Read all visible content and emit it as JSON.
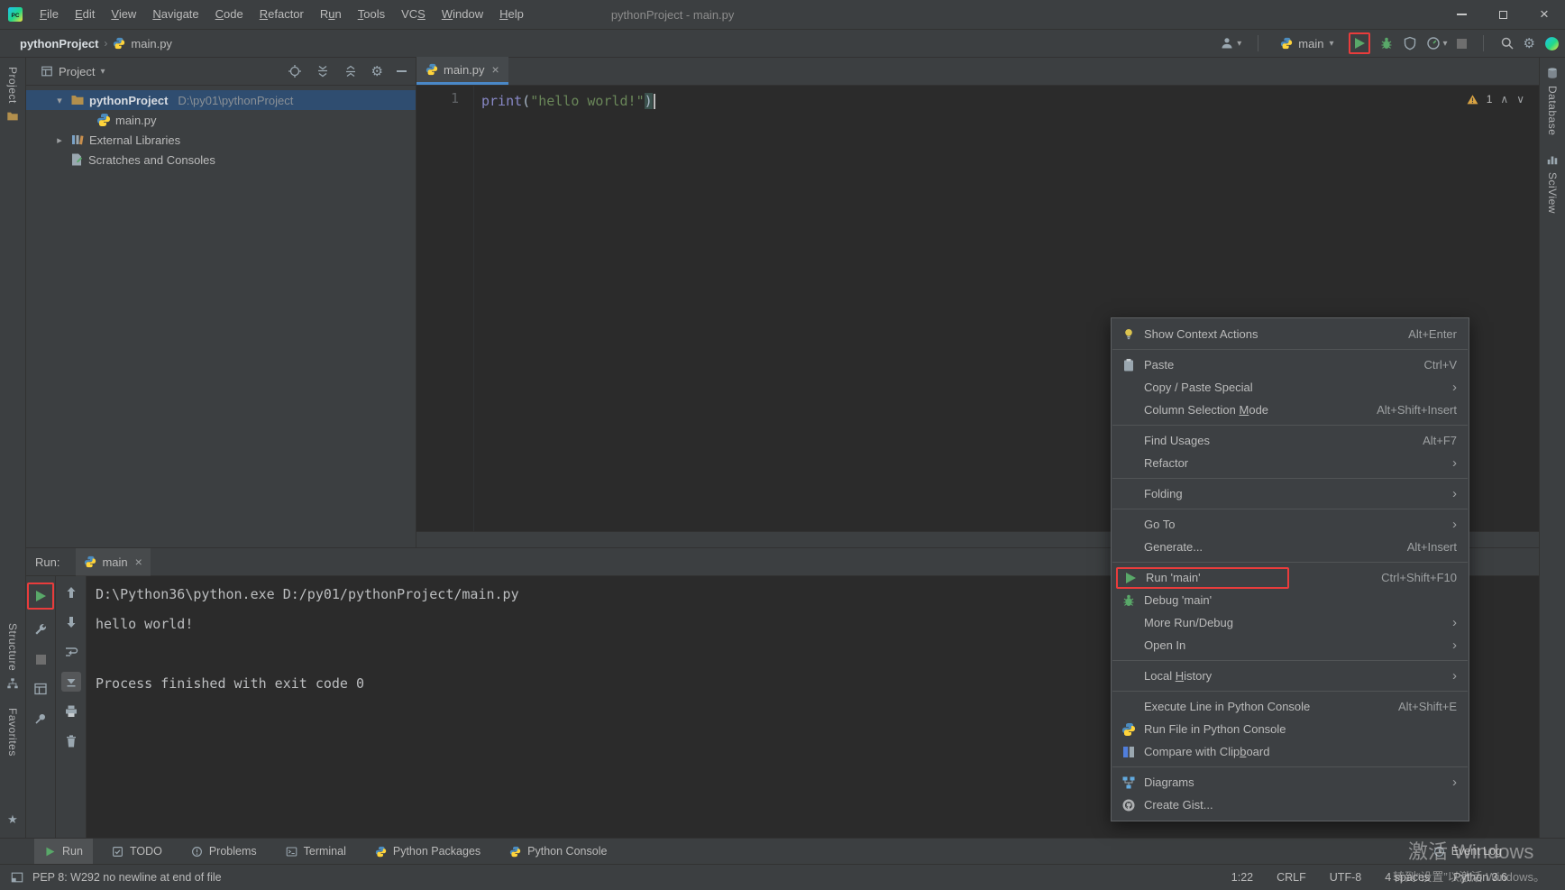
{
  "colors": {
    "annotation_red": "#e93c3c",
    "run_green": "#59a869",
    "selection_blue": "#2f4d70",
    "string_green": "#6a8759",
    "builtin_violet": "#8888c6",
    "panel_gray": "#3c3f41",
    "editor_dark": "#2b2b2b"
  },
  "titlebar": {
    "title": "pythonProject - main.py",
    "menus": [
      {
        "label": "File",
        "mnemonic": "F"
      },
      {
        "label": "Edit",
        "mnemonic": "E"
      },
      {
        "label": "View",
        "mnemonic": "V"
      },
      {
        "label": "Navigate",
        "mnemonic": "N"
      },
      {
        "label": "Code",
        "mnemonic": "C"
      },
      {
        "label": "Refactor",
        "mnemonic": "R"
      },
      {
        "label": "Run",
        "mnemonic": "u"
      },
      {
        "label": "Tools",
        "mnemonic": "T"
      },
      {
        "label": "VCS",
        "mnemonic": "S"
      },
      {
        "label": "Window",
        "mnemonic": "W"
      },
      {
        "label": "Help",
        "mnemonic": "H"
      }
    ]
  },
  "navbar": {
    "project_crumb": "pythonProject",
    "file_crumb": "main.py",
    "run_config": "main"
  },
  "left_stripe": {
    "project": "Project",
    "structure": "Structure",
    "favorites": "Favorites"
  },
  "right_stripe": {
    "database": "Database",
    "sciview": "SciView"
  },
  "project_panel": {
    "title": "Project",
    "tree": [
      {
        "name": "pythonProject",
        "path": "D:\\py01\\pythonProject"
      },
      {
        "name": "main.py"
      },
      {
        "name": "External Libraries"
      },
      {
        "name": "Scratches and Consoles"
      }
    ]
  },
  "editor": {
    "tab": "main.py",
    "line_number": "1",
    "code": {
      "keyword": "print",
      "open_paren": "(",
      "string": "\"hello world!\"",
      "close_paren": ")"
    },
    "warning_count": "1"
  },
  "run_panel": {
    "label": "Run:",
    "tab": "main",
    "console": [
      "D:\\Python36\\python.exe D:/py01/pythonProject/main.py",
      "hello world!",
      "",
      "Process finished with exit code 0"
    ]
  },
  "context_menu": {
    "items": [
      {
        "label": "Show Context Actions",
        "shortcut": "Alt+Enter"
      },
      {
        "label": "Paste",
        "shortcut": "Ctrl+V"
      },
      {
        "label": "Copy / Paste Special",
        "shortcut": ""
      },
      {
        "label": "Column Selection Mode",
        "shortcut": "Alt+Shift+Insert",
        "mnemonic": "M"
      },
      {
        "label": "Find Usages",
        "shortcut": "Alt+F7"
      },
      {
        "label": "Refactor",
        "shortcut": ""
      },
      {
        "label": "Folding",
        "shortcut": ""
      },
      {
        "label": "Go To",
        "shortcut": ""
      },
      {
        "label": "Generate...",
        "shortcut": "Alt+Insert"
      },
      {
        "label": "Run 'main'",
        "shortcut": "Ctrl+Shift+F10"
      },
      {
        "label": "Debug 'main'",
        "shortcut": ""
      },
      {
        "label": "More Run/Debug",
        "shortcut": ""
      },
      {
        "label": "Open In",
        "shortcut": ""
      },
      {
        "label": "Local History",
        "shortcut": "",
        "mnemonic": "H"
      },
      {
        "label": "Execute Line in Python Console",
        "shortcut": "Alt+Shift+E"
      },
      {
        "label": "Run File in Python Console",
        "shortcut": ""
      },
      {
        "label": "Compare with Clipboard",
        "shortcut": "",
        "mnemonic": "b"
      },
      {
        "label": "Diagrams",
        "shortcut": ""
      },
      {
        "label": "Create Gist...",
        "shortcut": ""
      }
    ]
  },
  "bottom_bar": {
    "tabs": [
      "Run",
      "TODO",
      "Problems",
      "Terminal",
      "Python Packages",
      "Python Console"
    ],
    "event_log": "Event Log"
  },
  "status_bar": {
    "message": "PEP 8: W292 no newline at end of file",
    "caret_position": "1:22",
    "line_separator": "CRLF",
    "encoding": "UTF-8",
    "indent": "4 spaces",
    "interpreter": "Python 3.6"
  },
  "watermark": {
    "line1": "激活 Windows",
    "line2": "转到“设置”以激活 Windows。"
  }
}
